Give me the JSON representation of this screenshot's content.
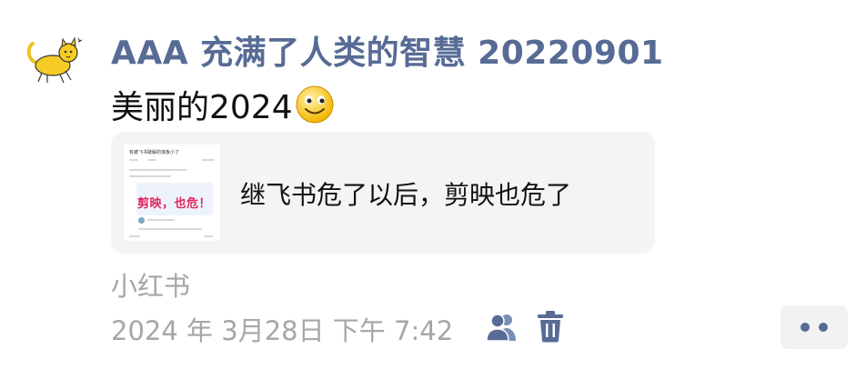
{
  "post": {
    "author": "AAA 充满了人类的智慧 20220901",
    "text": "美丽的2024",
    "emoji_icon": "smiling-face-emoji",
    "link_card": {
      "thumbnail": {
        "title": "有被飞书破解的滚板小了",
        "headline": "剪映，也危！"
      },
      "title": "继飞书危了以后，剪映也危了"
    },
    "source": "小红书",
    "timestamp": "2024 年 3月28日 下午 7:42",
    "actions": {
      "visibility_icon": "friends-icon",
      "delete_icon": "trash-icon",
      "more_icon": "more-dots-icon"
    }
  },
  "colors": {
    "author_blue": "#576b95",
    "text": "#111111",
    "meta_gray": "#a6a6a6",
    "card_bg": "#f4f4f4"
  }
}
